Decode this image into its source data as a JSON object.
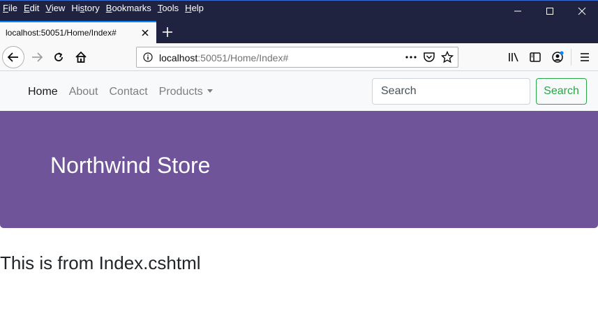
{
  "menu": [
    {
      "key": "F",
      "rest": "ile"
    },
    {
      "key": "E",
      "rest": "dit"
    },
    {
      "key": "V",
      "rest": "iew"
    },
    {
      "pre": "Hi",
      "key": "s",
      "rest": "tory"
    },
    {
      "key": "B",
      "rest": "ookmarks"
    },
    {
      "key": "T",
      "rest": "ools"
    },
    {
      "key": "H",
      "rest": "elp"
    }
  ],
  "tab": {
    "title": "localhost:50051/Home/Index#"
  },
  "urlbar": {
    "host": "localhost",
    "path": ":50051/Home/Index#"
  },
  "site": {
    "links": [
      {
        "label": "Home",
        "active": true
      },
      {
        "label": "About"
      },
      {
        "label": "Contact"
      },
      {
        "label": "Products"
      }
    ],
    "search_placeholder": "Search",
    "search_button": "Search"
  },
  "jumbotron": {
    "title": "Northwind Store"
  },
  "content": {
    "heading": "This is from Index.cshtml"
  },
  "colors": {
    "jumbotron": "#6f5499",
    "search_button": "#28a745",
    "chrome_dark": "#202340"
  }
}
